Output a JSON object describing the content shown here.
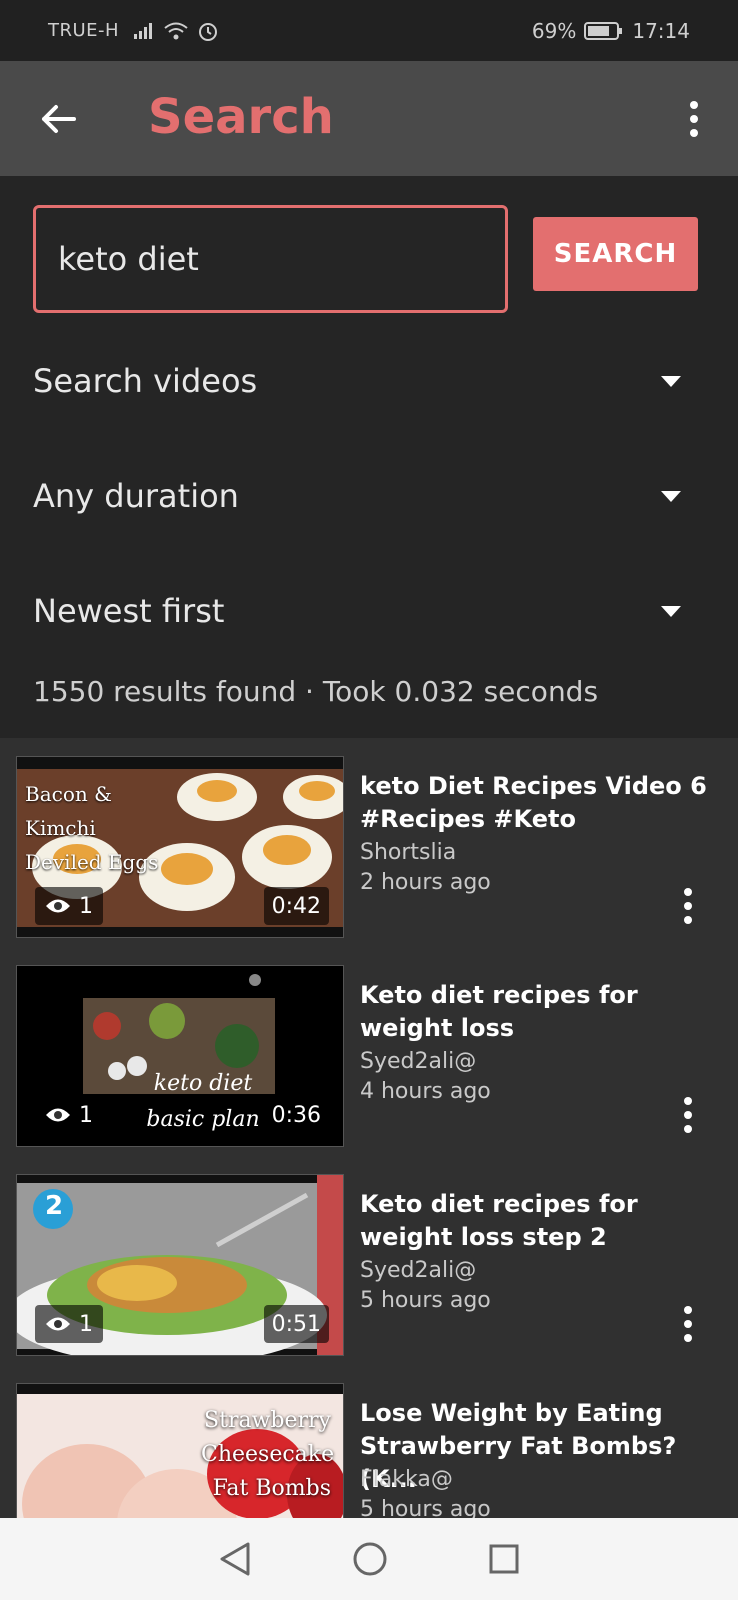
{
  "status": {
    "carrier": "TRUE-H",
    "battery": "69%",
    "time": "17:14"
  },
  "appbar": {
    "title": "Search"
  },
  "search": {
    "value": "keto diet",
    "button_label": "SEARCH"
  },
  "filters": {
    "type": "Search videos",
    "duration": "Any duration",
    "sort": "Newest first"
  },
  "results_meta": "1550 results found · Took 0.032 seconds",
  "videos": [
    {
      "title": "keto Diet Recipes  Video 6 #Recipes #Keto",
      "channel": "Shortslia",
      "time": "2 hours ago",
      "views": "1",
      "duration": "0:42",
      "overlay": "Bacon & Kimchi Deviled Eggs"
    },
    {
      "title": "Keto diet recipes for weight loss",
      "channel": "Syed2ali@",
      "time": "4 hours ago",
      "views": "1",
      "duration": "0:36",
      "overlay": "keto diet basic plan"
    },
    {
      "title": "Keto diet recipes for weight loss step 2",
      "channel": "Syed2ali@",
      "time": "5 hours ago",
      "views": "1",
      "duration": "0:51",
      "overlay": "2"
    },
    {
      "title": "Lose Weight by Eating Strawberry Fat Bombs? (K...",
      "channel": "Flakka@",
      "time": "5 hours ago",
      "views": "",
      "duration": "",
      "overlay": "Strawberry Cheesecake Fat Bombs"
    }
  ],
  "colors": {
    "accent": "#e36f6f",
    "background": "#252525",
    "list_background": "#303030",
    "appbar": "#4a4a4a"
  },
  "icons": [
    "back-arrow-icon",
    "more-vert-icon",
    "dropdown-caret-icon",
    "eye-icon",
    "nav-back-icon",
    "nav-home-icon",
    "nav-recents-icon"
  ]
}
